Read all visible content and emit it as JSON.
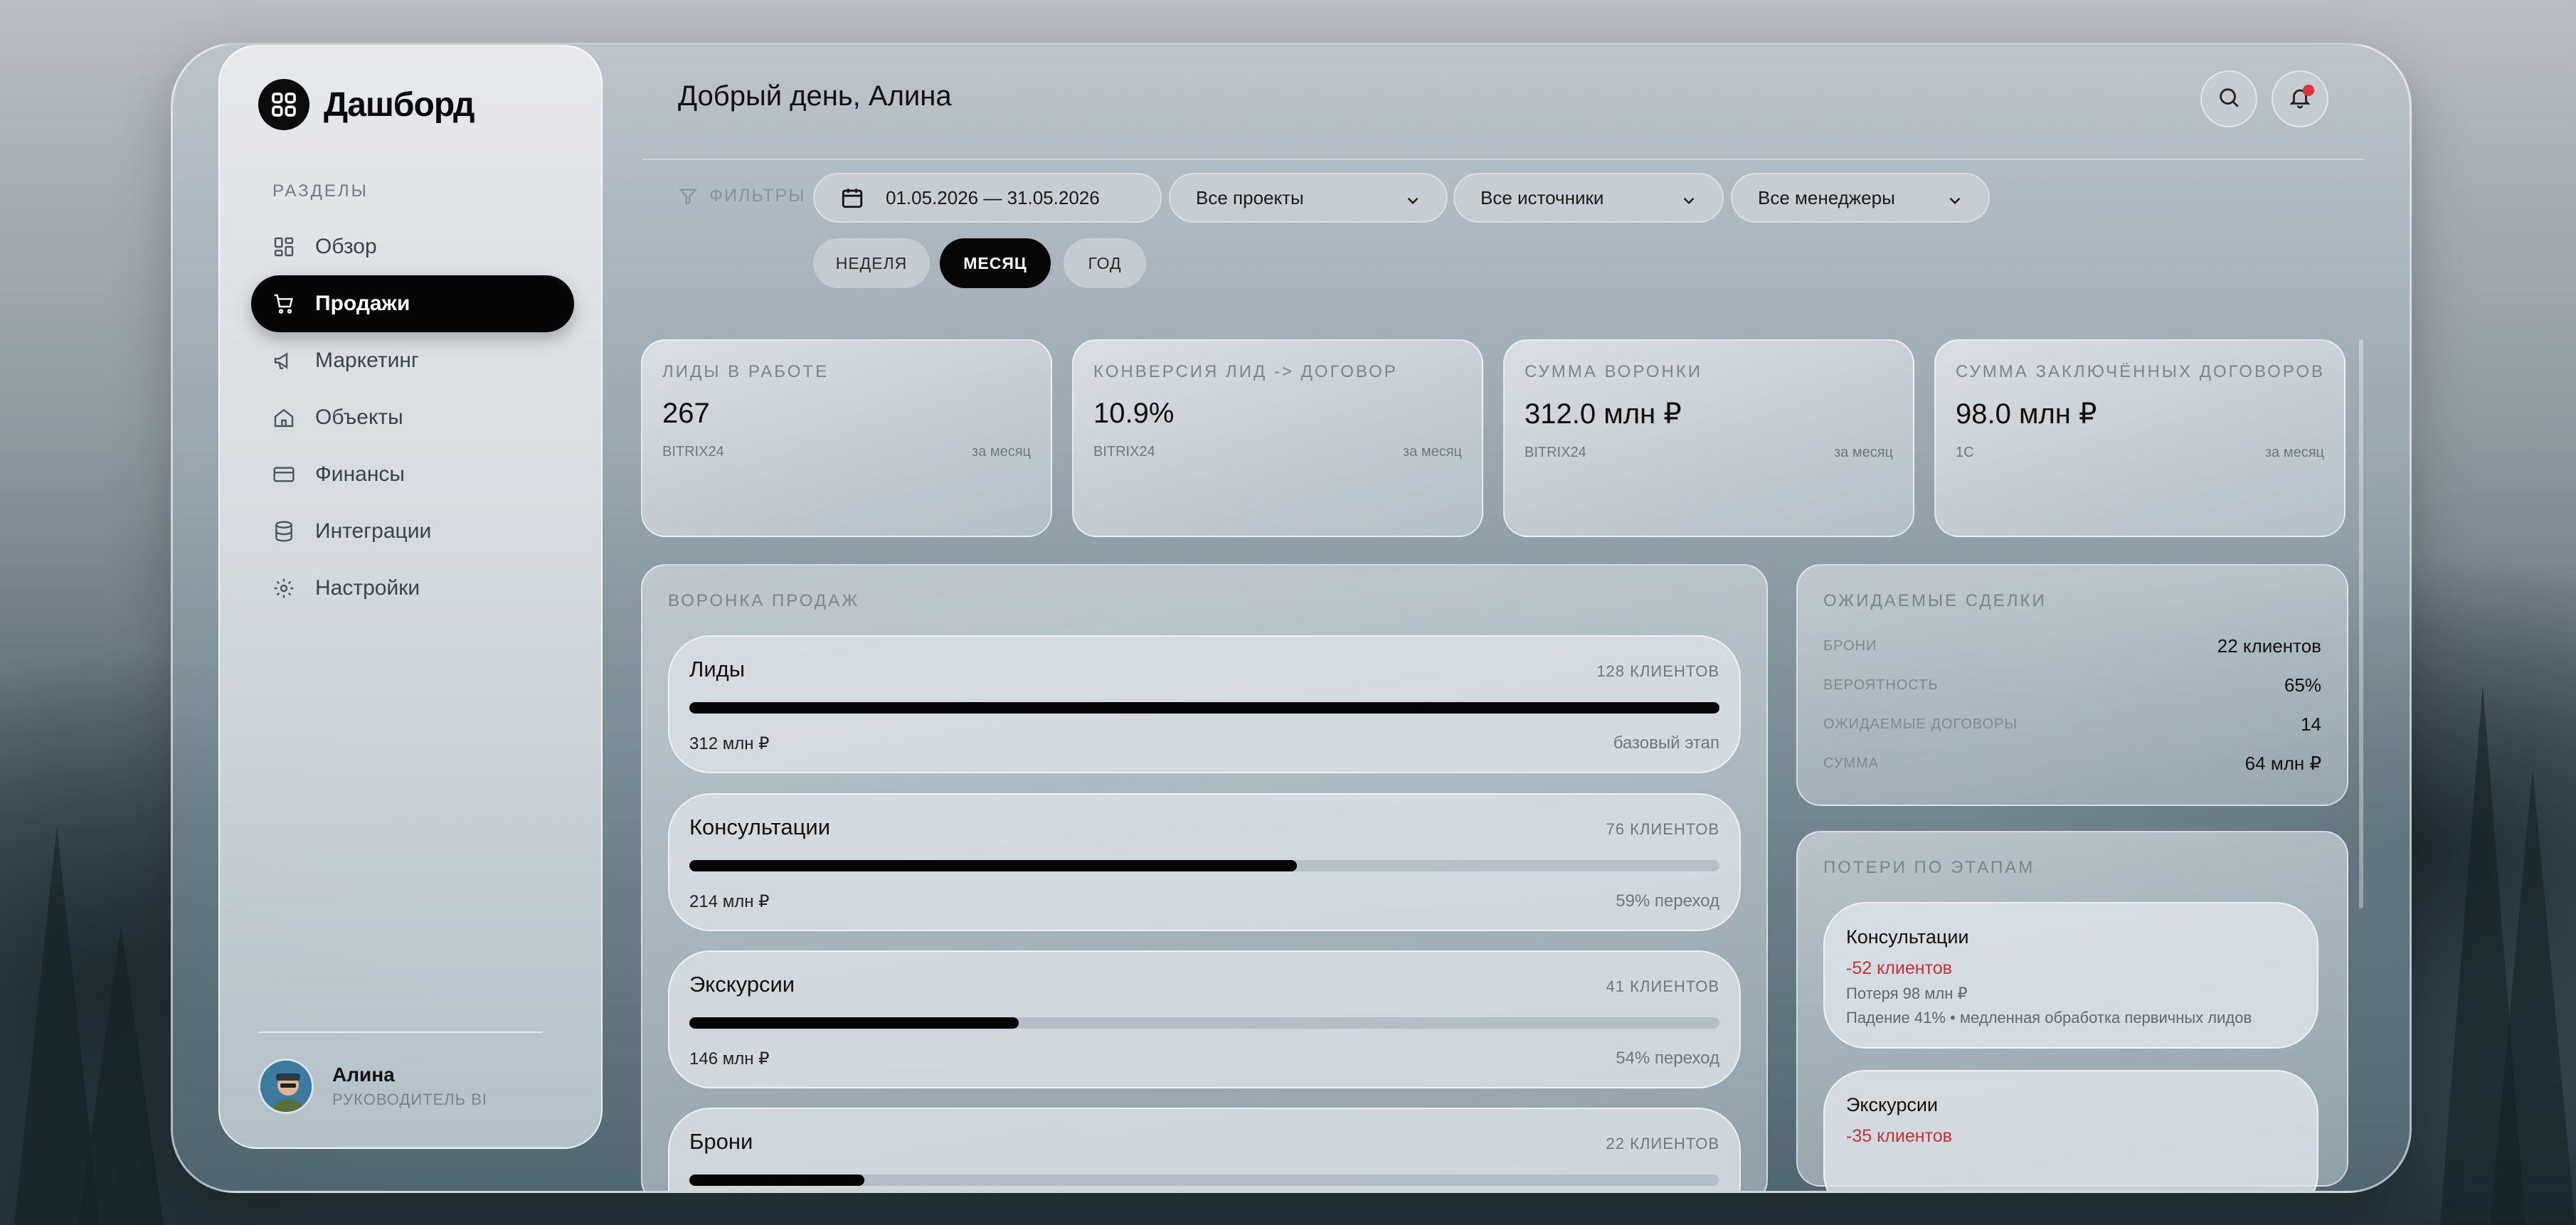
{
  "app": {
    "title": "Дашборд"
  },
  "sidebar": {
    "section_title": "РАЗДЕЛЫ",
    "items": [
      {
        "label": "Обзор",
        "icon": "dashboard-icon",
        "active": false
      },
      {
        "label": "Продажи",
        "icon": "cart-icon",
        "active": true
      },
      {
        "label": "Маркетинг",
        "icon": "megaphone-icon",
        "active": false
      },
      {
        "label": "Объекты",
        "icon": "home-icon",
        "active": false
      },
      {
        "label": "Финансы",
        "icon": "card-icon",
        "active": false
      },
      {
        "label": "Интеграции",
        "icon": "database-icon",
        "active": false
      },
      {
        "label": "Настройки",
        "icon": "gear-icon",
        "active": false
      }
    ],
    "user": {
      "name": "Алина",
      "role": "РУКОВОДИТЕЛЬ BI"
    }
  },
  "header": {
    "greeting": "Добрый день, Алина",
    "notification_color": "#e0323c"
  },
  "filters": {
    "label": "ФИЛЬТРЫ",
    "date_range": "01.05.2026 — 31.05.2026",
    "projects": "Все проекты",
    "sources": "Все источники",
    "managers": "Все менеджеры",
    "periods": [
      "НЕДЕЛЯ",
      "МЕСЯЦ",
      "ГОД"
    ],
    "active_period": "МЕСЯЦ"
  },
  "kpis": [
    {
      "label": "ЛИДЫ В РАБОТЕ",
      "value": "267",
      "source": "BITRIX24",
      "period": "за месяц"
    },
    {
      "label": "КОНВЕРСИЯ ЛИД -> ДОГОВОР",
      "value": "10.9%",
      "source": "BITRIX24",
      "period": "за месяц"
    },
    {
      "label": "СУММА ВОРОНКИ",
      "value": "312.0 млн ₽",
      "source": "BITRIX24",
      "period": "за месяц"
    },
    {
      "label": "СУММА ЗАКЛЮЧЁННЫХ ДОГОВОРОВ",
      "value": "98.0 млн ₽",
      "source": "1С",
      "period": "за месяц"
    }
  ],
  "funnel": {
    "title": "ВОРОНКА ПРОДАЖ",
    "stages": [
      {
        "name": "Лиды",
        "count": "128 КЛИЕНТОВ",
        "sum": "312 млн ₽",
        "note": "базовый этап",
        "progress": 1.0
      },
      {
        "name": "Консультации",
        "count": "76 КЛИЕНТОВ",
        "sum": "214 млн ₽",
        "note": "59% переход",
        "progress": 0.59
      },
      {
        "name": "Экскурсии",
        "count": "41 КЛИЕНТОВ",
        "sum": "146 млн ₽",
        "note": "54% переход",
        "progress": 0.32
      },
      {
        "name": "Брони",
        "count": "22 КЛИЕНТОВ",
        "sum": "",
        "note": "",
        "progress": 0.17
      }
    ]
  },
  "expected": {
    "title": "ОЖИДАЕМЫЕ СДЕЛКИ",
    "rows": [
      {
        "key": "БРОНИ",
        "value": "22 клиентов"
      },
      {
        "key": "ВЕРОЯТНОСТЬ",
        "value": "65%"
      },
      {
        "key": "ОЖИДАЕМЫЕ ДОГОВОРЫ",
        "value": "14"
      },
      {
        "key": "СУММА",
        "value": "64 млн ₽"
      }
    ]
  },
  "losses": {
    "title": "ПОТЕРИ ПО ЭТАПАМ",
    "items": [
      {
        "name": "Консультации",
        "delta": "-52 клиентов",
        "loss": "Потеря 98 млн ₽",
        "reason": "Падение 41% • медленная обработка первичных лидов"
      },
      {
        "name": "Экскурсии",
        "delta": "-35 клиентов",
        "loss": "",
        "reason": ""
      }
    ]
  }
}
